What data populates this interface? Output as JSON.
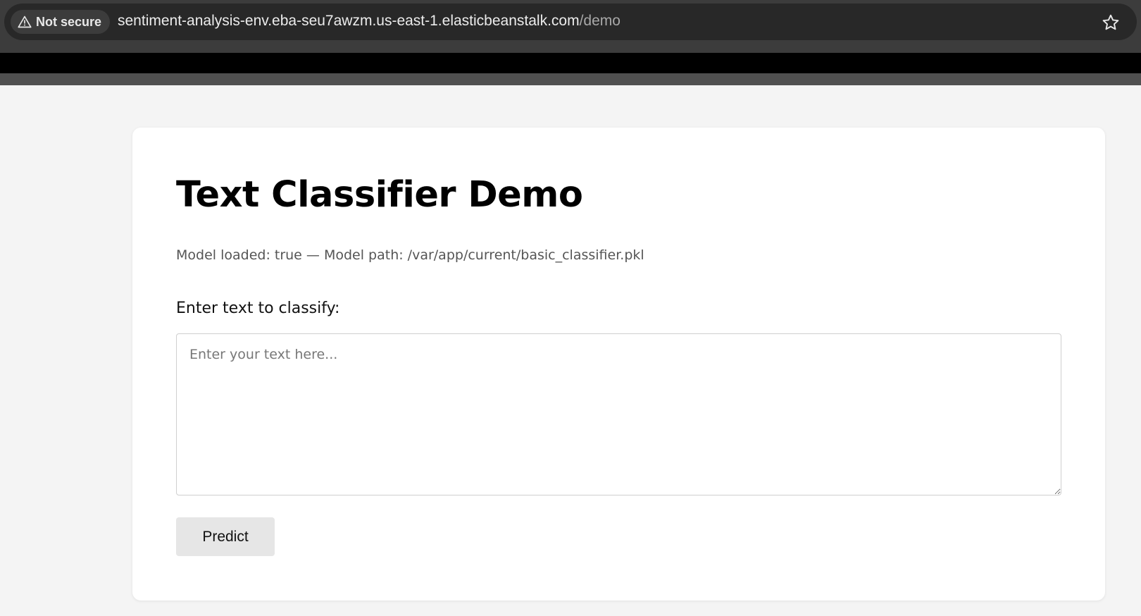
{
  "browser": {
    "security_label": "Not secure",
    "url_host": "sentiment-analysis-env.eba-seu7awzm.us-east-1.elasticbeanstalk.com",
    "url_path": "/demo",
    "icons": [
      "warning-triangle-icon",
      "star-icon"
    ]
  },
  "page": {
    "title": "Text Classifier Demo",
    "model_status": "Model loaded: true — Model path: /var/app/current/basic_classifier.pkl",
    "input_label": "Enter text to classify:",
    "input_placeholder": "Enter your text here...",
    "input_value": "",
    "predict_label": "Predict"
  },
  "colors": {
    "page_background": "#f4f4f4",
    "card_background": "#ffffff",
    "button_background": "#e6e6e6",
    "chrome_background": "#3c3c3c"
  }
}
